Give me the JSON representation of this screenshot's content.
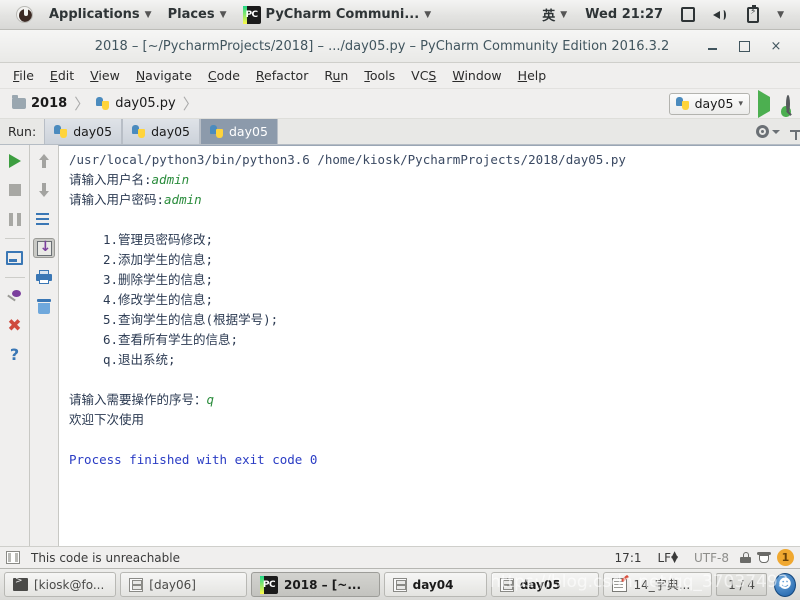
{
  "desktop": {
    "panel": {
      "applications": "Applications",
      "places": "Places",
      "active_window": "PyCharm Communi...",
      "input_method": "英",
      "clock": "Wed 21:27"
    },
    "taskbar": {
      "items": [
        {
          "label": "[kiosk@fo...",
          "icon": "terminal-icon",
          "active": false
        },
        {
          "label": "[day06]",
          "icon": "file-manager-icon",
          "active": false
        },
        {
          "label": "2018 – [~...",
          "icon": "pycharm-icon",
          "active": true
        },
        {
          "label": "day04",
          "icon": "file-manager-icon",
          "active": false
        },
        {
          "label": "day05",
          "icon": "file-manager-icon",
          "active": false
        },
        {
          "label": "14_字典...",
          "icon": "notepad-icon",
          "active": false
        }
      ],
      "pager": "1 / 4"
    },
    "watermark": "https://blog.csdn.net/qq_37037493"
  },
  "window": {
    "title": "2018 – [~/PycharmProjects/2018] – .../day05.py – PyCharm Community Edition 2016.3.2",
    "buttons": {
      "minimize": "minimize-button",
      "maximize": "maximize-button",
      "close": "×"
    }
  },
  "menubar": {
    "items": [
      {
        "pre": "",
        "key": "F",
        "post": "ile"
      },
      {
        "pre": "",
        "key": "E",
        "post": "dit"
      },
      {
        "pre": "",
        "key": "V",
        "post": "iew"
      },
      {
        "pre": "",
        "key": "N",
        "post": "avigate"
      },
      {
        "pre": "",
        "key": "C",
        "post": "ode"
      },
      {
        "pre": "",
        "key": "R",
        "post": "efactor"
      },
      {
        "pre": "R",
        "key": "u",
        "post": "n"
      },
      {
        "pre": "",
        "key": "T",
        "post": "ools"
      },
      {
        "pre": "VC",
        "key": "S",
        "post": ""
      },
      {
        "pre": "",
        "key": "W",
        "post": "indow"
      },
      {
        "pre": "",
        "key": "H",
        "post": "elp"
      }
    ]
  },
  "navbar": {
    "crumbs": [
      {
        "label": "2018",
        "icon": "folder-icon"
      },
      {
        "label": "day05.py",
        "icon": "python-file-icon"
      }
    ],
    "separator": "〉",
    "run_config": "day05",
    "run_config_caret": "▾",
    "actions": [
      "run-button",
      "debug-button",
      "search-everywhere-button"
    ]
  },
  "run_window": {
    "label": "Run:",
    "tabs": [
      {
        "label": "day05",
        "selected": false
      },
      {
        "label": "day05",
        "selected": false
      },
      {
        "label": "day05",
        "selected": true
      }
    ],
    "left_toolbar": [
      "rerun-icon",
      "stop-icon",
      "pause-icon",
      "show-console-icon",
      "pin-tab-icon",
      "close-icon",
      "help-icon"
    ],
    "right_toolbar": [
      "scroll-up-icon",
      "scroll-down-icon",
      "soft-wrap-icon",
      "scroll-to-end-icon",
      "print-icon",
      "clear-all-icon"
    ],
    "header_actions": [
      "settings-gear-icon",
      "hide-window-icon"
    ],
    "console": {
      "lines": [
        {
          "text": "/usr/local/python3/bin/python3.6 /home/kiosk/PycharmProjects/2018/day05.py",
          "style": "cmd"
        },
        {
          "text": "请输入用户名:",
          "input": "admin",
          "style": "prompt"
        },
        {
          "text": "请输入用户密码:",
          "input": "admin",
          "style": "prompt"
        },
        {
          "text": "",
          "style": "blank"
        },
        {
          "text": "1.管理员密码修改;",
          "style": "indent"
        },
        {
          "text": "2.添加学生的信息;",
          "style": "indent"
        },
        {
          "text": "3.删除学生的信息;",
          "style": "indent"
        },
        {
          "text": "4.修改学生的信息;",
          "style": "indent"
        },
        {
          "text": "5.查询学生的信息(根据学号);",
          "style": "indent"
        },
        {
          "text": "6.查看所有学生的信息;",
          "style": "indent"
        },
        {
          "text": "q.退出系统;",
          "style": "indent"
        },
        {
          "text": "",
          "style": "blank"
        },
        {
          "text": "请输入需要操作的序号：",
          "input": "q",
          "style": "prompt"
        },
        {
          "text": "欢迎下次使用",
          "style": "plain"
        },
        {
          "text": "",
          "style": "blank"
        },
        {
          "text": "Process finished with exit code 0",
          "style": "blue"
        }
      ]
    }
  },
  "statusbar": {
    "message": "This code is unreachable",
    "caret": "17:1",
    "line_separator": "LF",
    "encoding": "UTF-8",
    "badge_count": "1"
  },
  "colors": {
    "accent_green": "#4caf50",
    "console_input": "#2a8c3c",
    "console_exit": "#2a3cc4",
    "badge": "#f0a830",
    "selected_tab": "#8c9aab"
  }
}
